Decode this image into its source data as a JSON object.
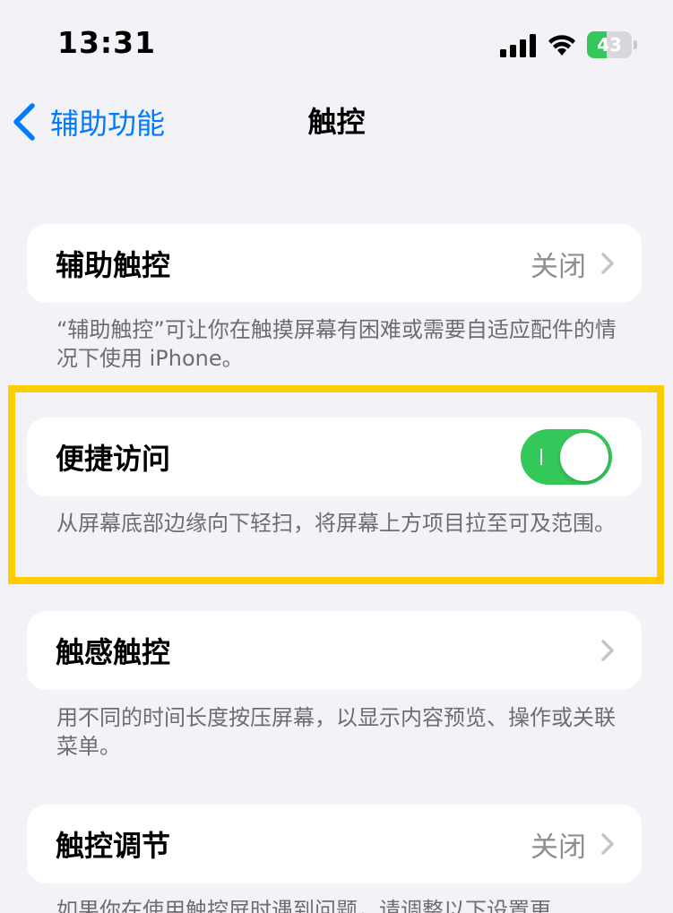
{
  "status_bar": {
    "time": "13:31",
    "battery_level": "43",
    "battery_percent": 43,
    "battery_color": "#34c759"
  },
  "nav": {
    "back_label": "辅助功能",
    "title": "触控",
    "accent_color": "#007aff"
  },
  "sections": [
    {
      "label": "辅助触控",
      "value": "关闭",
      "footer": "“辅助触控”可让你在触摸屏幕有困难或需要自适应配件的情况下使用 iPhone。"
    },
    {
      "label": "便捷访问",
      "toggle_on": true,
      "footer": "从屏幕底部边缘向下轻扫，将屏幕上方项目拉至可及范围。"
    },
    {
      "label": "触感触控",
      "footer": "用不同的时间长度按压屏幕，以显示内容预览、操作或关联菜单。"
    },
    {
      "label": "触控调节",
      "value": "关闭",
      "footer": "如果你在使用触控屏时遇到问题，请调整以下设置更"
    }
  ],
  "highlight_color": "#ffcc00"
}
